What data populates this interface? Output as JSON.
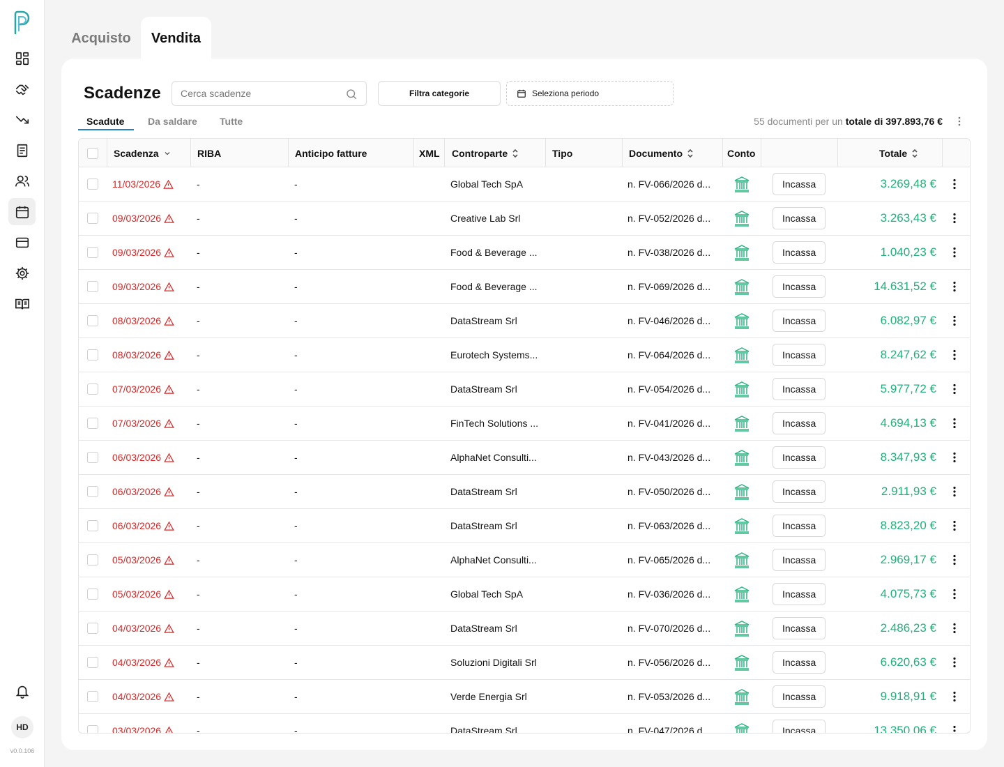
{
  "app": {
    "version": "v0.0.106",
    "avatar_initials": "HD"
  },
  "sidebar": {
    "items": [
      {
        "icon": "dashboard-icon"
      },
      {
        "icon": "handshake-icon"
      },
      {
        "icon": "trend-icon"
      },
      {
        "icon": "document-icon"
      },
      {
        "icon": "users-icon"
      },
      {
        "icon": "calendar-icon",
        "active": true
      },
      {
        "icon": "credit-card-icon"
      },
      {
        "icon": "gear-icon"
      },
      {
        "icon": "book-icon"
      }
    ],
    "bottom": {
      "icon": "bell-icon"
    }
  },
  "top_tabs": {
    "acquisto": "Acquisto",
    "vendita": "Vendita"
  },
  "header": {
    "title": "Scadenze",
    "search_placeholder": "Cerca scadenze",
    "filter_label": "Filtra categorie",
    "period_label": "Seleziona periodo"
  },
  "sub_tabs": {
    "scadute": "Scadute",
    "da_saldare": "Da saldare",
    "tutte": "Tutte"
  },
  "summary": {
    "prefix": "55 documenti per un",
    "total": "totale di 397.893,76 €"
  },
  "table": {
    "columns": {
      "scadenza": "Scadenza",
      "riba": "RIBA",
      "anticipo": "Anticipo fatture",
      "xml": "XML",
      "controparte": "Controparte",
      "tipo": "Tipo",
      "documento": "Documento",
      "conto": "Conto",
      "totale": "Totale"
    },
    "action_label": "Incassa",
    "rows": [
      {
        "date": "11/03/2026",
        "riba": "-",
        "anticipo": "-",
        "party": "Global Tech SpA",
        "doc": "n. FV-066/2026 d...",
        "total": "3.269,48 €"
      },
      {
        "date": "09/03/2026",
        "riba": "-",
        "anticipo": "-",
        "party": "Creative Lab Srl",
        "doc": "n. FV-052/2026 d...",
        "total": "3.263,43 €"
      },
      {
        "date": "09/03/2026",
        "riba": "-",
        "anticipo": "-",
        "party": "Food & Beverage ...",
        "doc": "n. FV-038/2026 d...",
        "total": "1.040,23 €"
      },
      {
        "date": "09/03/2026",
        "riba": "-",
        "anticipo": "-",
        "party": "Food & Beverage ...",
        "doc": "n. FV-069/2026 d...",
        "total": "14.631,52 €"
      },
      {
        "date": "08/03/2026",
        "riba": "-",
        "anticipo": "-",
        "party": "DataStream Srl",
        "doc": "n. FV-046/2026 d...",
        "total": "6.082,97 €"
      },
      {
        "date": "08/03/2026",
        "riba": "-",
        "anticipo": "-",
        "party": "Eurotech Systems...",
        "doc": "n. FV-064/2026 d...",
        "total": "8.247,62 €"
      },
      {
        "date": "07/03/2026",
        "riba": "-",
        "anticipo": "-",
        "party": "DataStream Srl",
        "doc": "n. FV-054/2026 d...",
        "total": "5.977,72 €"
      },
      {
        "date": "07/03/2026",
        "riba": "-",
        "anticipo": "-",
        "party": "FinTech Solutions ...",
        "doc": "n. FV-041/2026 d...",
        "total": "4.694,13 €"
      },
      {
        "date": "06/03/2026",
        "riba": "-",
        "anticipo": "-",
        "party": "AlphaNet Consulti...",
        "doc": "n. FV-043/2026 d...",
        "total": "8.347,93 €"
      },
      {
        "date": "06/03/2026",
        "riba": "-",
        "anticipo": "-",
        "party": "DataStream Srl",
        "doc": "n. FV-050/2026 d...",
        "total": "2.911,93 €"
      },
      {
        "date": "06/03/2026",
        "riba": "-",
        "anticipo": "-",
        "party": "DataStream Srl",
        "doc": "n. FV-063/2026 d...",
        "total": "8.823,20 €"
      },
      {
        "date": "05/03/2026",
        "riba": "-",
        "anticipo": "-",
        "party": "AlphaNet Consulti...",
        "doc": "n. FV-065/2026 d...",
        "total": "2.969,17 €"
      },
      {
        "date": "05/03/2026",
        "riba": "-",
        "anticipo": "-",
        "party": "Global Tech SpA",
        "doc": "n. FV-036/2026 d...",
        "total": "4.075,73 €"
      },
      {
        "date": "04/03/2026",
        "riba": "-",
        "anticipo": "-",
        "party": "DataStream Srl",
        "doc": "n. FV-070/2026 d...",
        "total": "2.486,23 €"
      },
      {
        "date": "04/03/2026",
        "riba": "-",
        "anticipo": "-",
        "party": "Soluzioni Digitali Srl",
        "doc": "n. FV-056/2026 d...",
        "total": "6.620,63 €"
      },
      {
        "date": "04/03/2026",
        "riba": "-",
        "anticipo": "-",
        "party": "Verde Energia Srl",
        "doc": "n. FV-053/2026 d...",
        "total": "9.918,91 €"
      },
      {
        "date": "03/03/2026",
        "riba": "-",
        "anticipo": "-",
        "party": "DataStream Srl",
        "doc": "n. FV-047/2026 d...",
        "total": "13.350,06 €"
      }
    ]
  },
  "colors": {
    "overdue": "#d92525",
    "amount": "#20b07a",
    "accent": "#1f7fc4",
    "bank_icon": "#2fb584"
  }
}
